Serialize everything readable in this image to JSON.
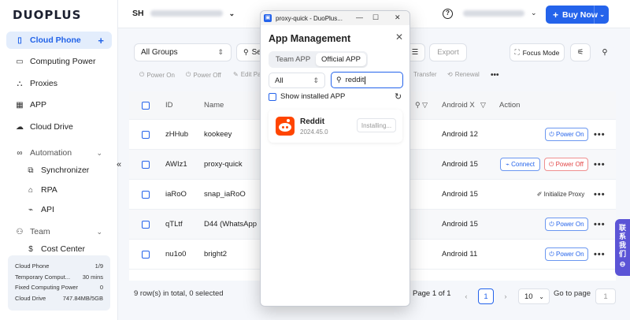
{
  "brand": "DUOPLUS",
  "sidebar": {
    "items": [
      {
        "label": "Cloud Phone",
        "icon": "phone-icon"
      },
      {
        "label": "Computing Power",
        "icon": "monitor-icon"
      },
      {
        "label": "Proxies",
        "icon": "network-icon"
      },
      {
        "label": "APP",
        "icon": "grid-icon"
      },
      {
        "label": "Cloud Drive",
        "icon": "cloud-icon"
      }
    ],
    "automation": {
      "label": "Automation",
      "items": [
        "Synchronizer",
        "RPA",
        "API"
      ]
    },
    "team": {
      "label": "Team",
      "items": [
        "Cost Center"
      ]
    },
    "usage": [
      {
        "label": "Cloud Phone",
        "value": "1/9"
      },
      {
        "label": "Temporary Comput...",
        "value": "30 mins"
      },
      {
        "label": "Fixed Computing Power",
        "value": "0"
      },
      {
        "label": "Cloud Drive",
        "value": "747.84MB/5GB"
      }
    ]
  },
  "header": {
    "workspace_prefix": "SH",
    "buy_now": "Buy Now"
  },
  "toolbar": {
    "group_select": "All Groups",
    "search_prefix": "Se",
    "export": "Export",
    "focus_mode": "Focus Mode",
    "actions": [
      "Power On",
      "Power Off",
      "Edit Pa",
      "Transfer",
      "Renewal"
    ]
  },
  "table": {
    "headers": {
      "id": "ID",
      "name": "Name",
      "android": "Android X",
      "action": "Action"
    },
    "rows": [
      {
        "id": "zHHub",
        "name": "kookeey",
        "android": "Android 12"
      },
      {
        "id": "AWIz1",
        "name": "proxy-quick",
        "android": "Android 15"
      },
      {
        "id": "iaRoO",
        "name": "snap_iaRoO",
        "android": "Android 15"
      },
      {
        "id": "qTLtf",
        "name": "D44 (WhatsApp",
        "android": "Android 15"
      },
      {
        "id": "nu1o0",
        "name": "bright2",
        "android": "Android 11"
      }
    ],
    "actions": {
      "power_on": "Power On",
      "power_off": "Power Off",
      "connect": "Connect",
      "init_proxy": "Initialize Proxy"
    }
  },
  "footer": {
    "summary": "9 row(s) in total, 0 selected",
    "page_info": "Page 1 of 1",
    "current_page": "1",
    "page_size": "10",
    "goto_label": "Go to page",
    "goto_value": "1"
  },
  "side_tab": {
    "label": "联系我们"
  },
  "popup": {
    "window_title": "proxy-quick - DuoPlus...",
    "heading": "App Management",
    "tabs": [
      "Team APP",
      "Official APP"
    ],
    "active_tab": "Official APP",
    "filter": "All",
    "search_value": "reddit",
    "show_installed": "Show installed APP",
    "app": {
      "name": "Reddit",
      "version": "2024.45.0",
      "status": "Installing..."
    }
  },
  "colors": {
    "accent": "#2463eb",
    "danger": "#e24545",
    "reddit": "#ff4500",
    "contact": "#5b54d6"
  }
}
